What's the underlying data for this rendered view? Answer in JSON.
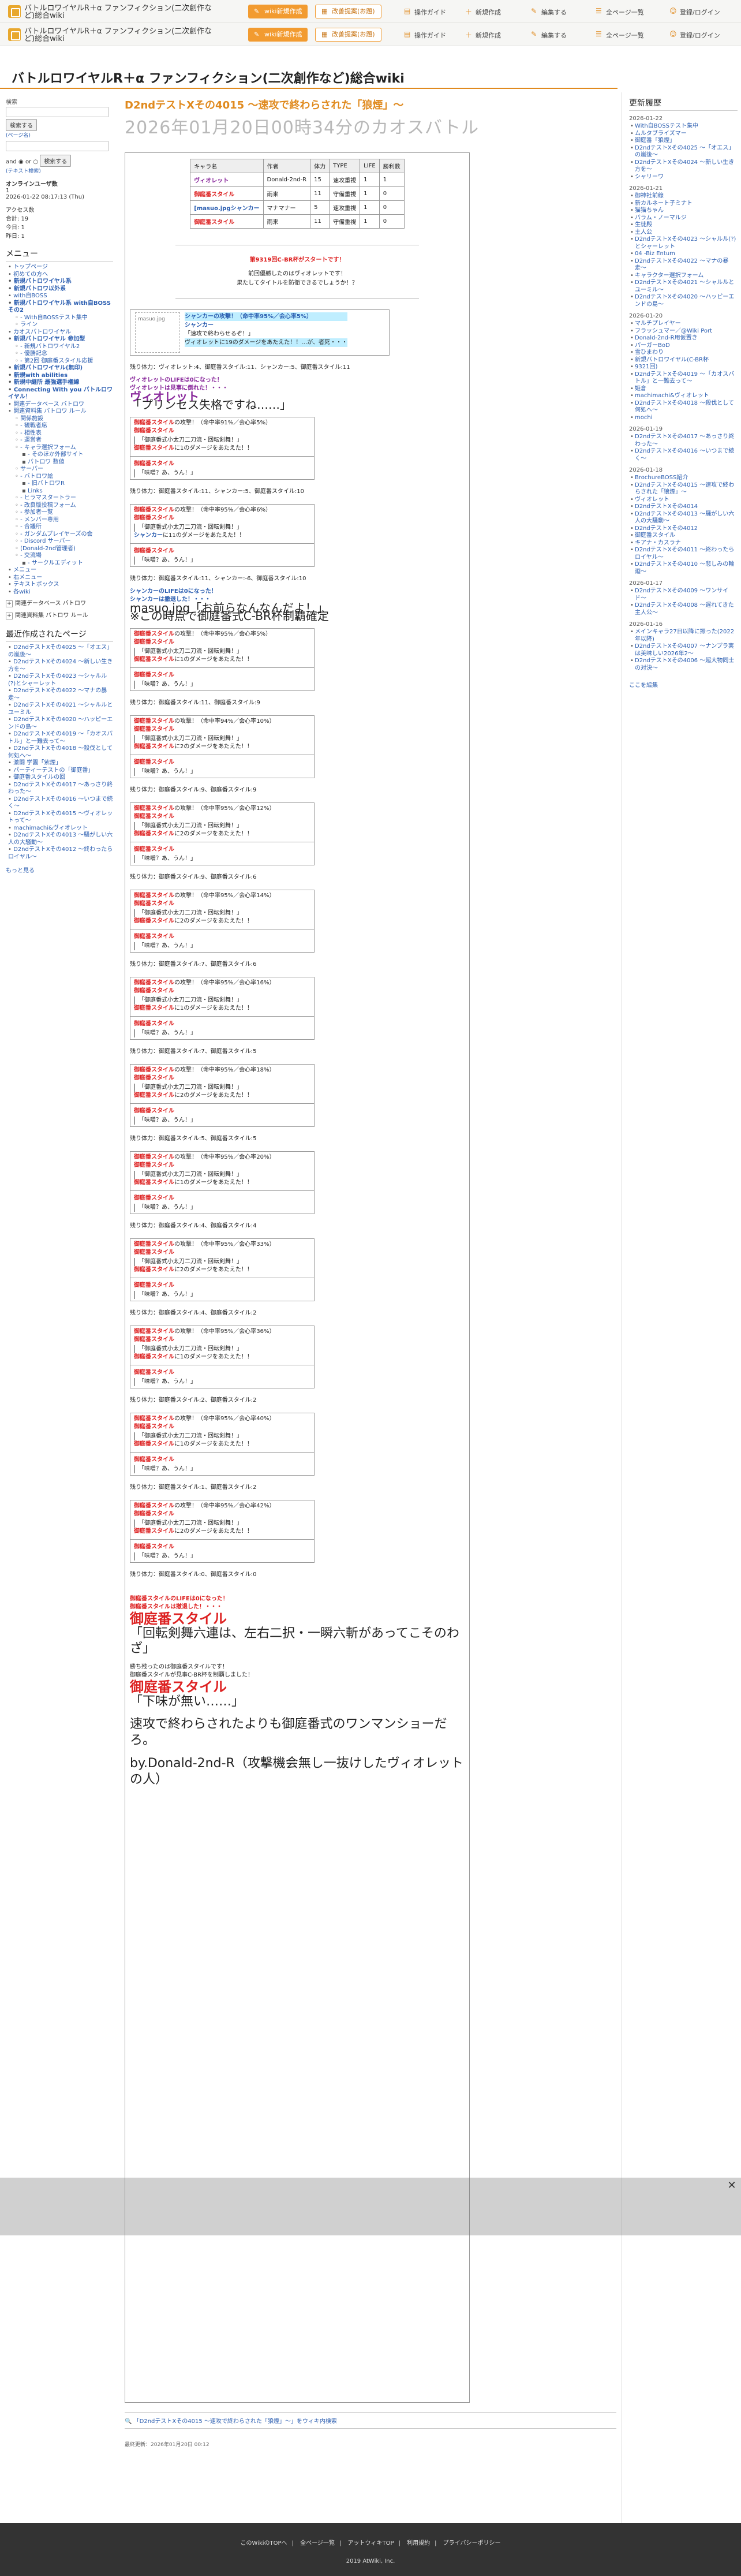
{
  "header": {
    "site_name": "バトルロワイヤルR＋α ファンフィクション(二次創作など)総合wiki",
    "wiki_new": "wiki新規作成",
    "feedback": "改善提案(お題)",
    "nav": [
      "操作ガイド",
      "新規作成",
      "編集する",
      "全ページ一覧",
      "登録/ログイン"
    ]
  },
  "wiki_title": "バトルロワイヤルR＋α ファンフィクション(二次創作など)総合wiki",
  "left": {
    "search_label": "検索",
    "search_button": "検索する",
    "search_label2": "(ページ名)",
    "and_label": "and",
    "or_label": "or",
    "search_button2": "検索する",
    "search_hint": "(テキスト検索)",
    "online_label": "オンラインユーザ数",
    "online_count": "1",
    "datetime": "2026-01-22 08:17:13 (Thu)",
    "access_label": "アクセス数",
    "access_total": "合計: 19",
    "access_today": "今日: 1",
    "access_yesterday": "昨日: 1",
    "menu_title": "メニュー",
    "menu": [
      {
        "t": "トップページ",
        "l": 1
      },
      {
        "t": "初めての方へ",
        "l": 1
      },
      {
        "t": "新規バトロワイヤル系",
        "l": 1,
        "s": true
      },
      {
        "t": "新規バトロワ以外系",
        "l": 1,
        "s": true
      },
      {
        "t": "with自BOSS",
        "l": 1
      },
      {
        "t": "新規バトロワイヤル系 with自BOSS その2",
        "l": 1,
        "s": true
      },
      {
        "t": "- With自BOSSテスト集中",
        "l": 2
      },
      {
        "t": "ライン",
        "l": 2
      },
      {
        "t": "カオスバトロワイヤル",
        "l": 1
      },
      {
        "t": "新規バトロワイヤル 参加型",
        "l": 1,
        "s": true
      },
      {
        "t": "- 新規バトロワイヤル2",
        "l": 2
      },
      {
        "t": "- 優勝記念",
        "l": 2
      },
      {
        "t": "- 第2回 御庭番スタイル応援",
        "l": 2
      },
      {
        "t": "新規バトロワイヤル(無印)",
        "l": 1,
        "s": true
      },
      {
        "t": "新規with abilities",
        "l": 1,
        "s": true
      },
      {
        "t": "新規中継所 最強選手権線",
        "l": 1,
        "s": true
      },
      {
        "t": "Connecting With you バトルロワイヤル！",
        "l": 1,
        "s": true
      },
      {
        "t": "関連データベース バトロワ",
        "l": 1
      },
      {
        "t": "関連資料集 バトロワ ルール",
        "l": 1
      },
      {
        "t": "関係施設",
        "l": 2
      },
      {
        "t": "- 観戦者席",
        "l": 2
      },
      {
        "t": "- 相性表",
        "l": 2
      },
      {
        "t": "- 運営者",
        "l": 2
      },
      {
        "t": "- キャラ選択フォーム",
        "l": 2
      },
      {
        "t": "- そのほか外部サイト",
        "l": 3
      },
      {
        "t": "バトロワ 数値 ",
        "l": 3
      },
      {
        "t": "サーバー",
        "l": 2
      },
      {
        "t": "- バトロワ絵",
        "l": 2
      },
      {
        "t": "- 旧バトロワR",
        "l": 3
      },
      {
        "t": "Links",
        "l": 3
      },
      {
        "t": "- ヒラマスタートラー",
        "l": 2
      },
      {
        "t": "- 改良版投稿フォーム",
        "l": 2
      },
      {
        "t": "- 参加者一覧 ",
        "l": 2
      },
      {
        "t": "- メンバー専用",
        "l": 2
      },
      {
        "t": "- 合議所",
        "l": 2
      },
      {
        "t": "- ガンダムプレイヤーズの会",
        "l": 2
      },
      {
        "t": "- Discord サーバー",
        "l": 2
      },
      {
        "t": "(Donald-2nd管理者)",
        "l": 2
      },
      {
        "t": "- 交流場",
        "l": 2
      },
      {
        "t": "- サークルエディット",
        "l": 3
      },
      {
        "t": "メニュー",
        "l": 1
      },
      {
        "t": "右メニュー",
        "l": 1
      },
      {
        "t": "テキストボックス",
        "l": 1
      },
      {
        "t": "各wiki",
        "l": 1
      }
    ],
    "toggles": [
      "関連データベース バトロワ",
      "関連資料集 バトロワ ルール"
    ],
    "recent_title": "最近作成されたページ",
    "recent": [
      "D2ndテストXその4025 〜「オエス」の嵐後〜",
      "D2ndテストXその4024 〜新しい生き方を〜",
      "D2ndテストXその4023 〜シャルル(?)とシャーレット",
      "D2ndテストXその4022 〜マナの暴走〜",
      "D2ndテストXその4021 〜シャルルとユーミル",
      "D2ndテストXその4020 〜ハッピーエンドの島〜",
      "D2ndテストXその4019 〜「カオスバトル」と一難去って〜",
      "D2ndテストXその4018 〜殺伐として何処へ〜",
      "激闘 学園「紫煙」",
      "パーティーテストの「御庭番」",
      "御庭番スタイルの回",
      "D2ndテストXその4017 〜あっさり終わった〜",
      "D2ndテストXその4016 〜いつまで続く〜",
      "D2ndテストXその4015 〜ヴィオレットって〜",
      "machimachi&ヴィオレット",
      "D2ndテストXその4013 〜騒がしい六人の大騒動〜",
      "D2ndテストXその4012 〜終わったらロイヤル〜"
    ],
    "more": "もっと見る"
  },
  "article": {
    "title": "D2ndテストXその4015 〜速攻で終わらされた「狼煙」〜",
    "date": "2026年01月20日00時34分のカオスバトル",
    "roster_headers": [
      "キャラ名",
      "作者",
      "体力",
      "TYPE",
      "LIFE",
      "勝利数"
    ],
    "roster": [
      {
        "name": "ヴィオレット",
        "author": "Donald-2nd-R",
        "hp": "15",
        "type": "速攻重視",
        "life": "1",
        "wins": "1",
        "c": "purple"
      },
      {
        "name": "御庭番スタイル",
        "author": "雨来",
        "hp": "11",
        "type": "守備重視",
        "life": "1",
        "wins": "0",
        "c": "red"
      },
      {
        "name": "シャンカー",
        "author": "マナマナー",
        "hp": "5",
        "type": "速攻重視",
        "life": "1",
        "wins": "0",
        "c": "blue",
        "img": "[masuo.jpg"
      },
      {
        "name": "御庭番スタイル",
        "author": "雨来",
        "hp": "11",
        "type": "守備重視",
        "life": "1",
        "wins": "0",
        "c": "red"
      }
    ],
    "start_line1": "第9319回C-BR杯がスタートです！",
    "start_line2": "前回優勝したのはヴィオレットです！",
    "start_line3": "果たしてタイトルを防衛できるでしょうか！？",
    "scene_img": "masuo.jpg",
    "scene_lines": [
      "シャンカーの攻撃！（命中率95%／会心率5%）",
      "シャンカー",
      "「速攻で終わらせるぞ！」",
      "ヴィオレットに19のダメージをあたえた！！…が、者死・・・"
    ],
    "remain1": "残り体力：ヴィオレット:4、御庭番スタイル:11、シャンカー:5、御庭番スタイル:11",
    "life_lost": "ヴィオレットのLIFEは0になった！",
    "life_lost2": "ヴィオレットは見事に倒れた！・・・",
    "violet_name": "ヴィオレット",
    "violet_quote": "「プリンセス失格ですね……」",
    "turns": [
      {
        "hit": "（命中率91%／会心率5%）",
        "dmg": "1",
        "remain": "残り体力：御庭番スタイル:11、シャンカー:5、御庭番スタイル:10"
      },
      {
        "hit": "（命中率95%／会心率6%）",
        "dmg": "11",
        "target": "シャンカー",
        "remain": "残り体力：御庭番スタイル:11、シャンカー:-6、御庭番スタイル:10"
      },
      {
        "hit": "（命中率95%／会心率5%）",
        "dmg": "1",
        "remain": "残り体力：御庭番スタイル:11、御庭番スタイル:9"
      },
      {
        "hit": "（命中率94%／会心率10%）",
        "dmg": "2",
        "remain": "残り体力：御庭番スタイル:9、御庭番スタイル:9"
      },
      {
        "hit": "（命中率95%／会心率12%）",
        "dmg": "2",
        "remain": "残り体力：御庭番スタイル:9、御庭番スタイル:6"
      },
      {
        "hit": "（命中率95%／会心率14%）",
        "dmg": "2",
        "remain": "残り体力：御庭番スタイル:7、御庭番スタイル:6"
      },
      {
        "hit": "（命中率95%／会心率16%）",
        "dmg": "1",
        "remain": "残り体力：御庭番スタイル:7、御庭番スタイル:5"
      },
      {
        "hit": "（命中率95%／会心率18%）",
        "dmg": "2",
        "remain": "残り体力：御庭番スタイル:5、御庭番スタイル:5"
      },
      {
        "hit": "（命中率95%／会心率20%）",
        "dmg": "1",
        "remain": "残り体力：御庭番スタイル:4、御庭番スタイル:4"
      },
      {
        "hit": "（命中率95%／会心率33%）",
        "dmg": "2",
        "remain": "残り体力：御庭番スタイル:4、御庭番スタイル:2"
      },
      {
        "hit": "（命中率95%／会心率36%）",
        "dmg": "1",
        "remain": "残り体力：御庭番スタイル:2、御庭番スタイル:2"
      },
      {
        "hit": "（命中率95%／会心率40%）",
        "dmg": "1",
        "remain": "残り体力：御庭番スタイル:1、御庭番スタイル:2"
      },
      {
        "hit": "（命中率95%／会心率42%）",
        "dmg": "2",
        "remain": "残り体力：御庭番スタイル:0、御庭番スタイル:0"
      }
    ],
    "shanker_dead1": "シャンカーのLIFEは0になった！",
    "shanker_dead2": "シャンカーは撤退した！・・・",
    "shanker_img": "masuo.jpg",
    "shanker_quote": "「お前らなんなんだよ！」",
    "note": "※この時点で御庭番式C-BR杯制覇確定",
    "attack_line": "の攻撃！",
    "oniwaban": "御庭番スタイル",
    "tech_line": "「御庭番式小太刀二刀流・回転剣舞！」",
    "dmg_prefix": "に",
    "dmg_suffix": "のダメージをあたえた！！",
    "reply_line": "「味噌？あ、うん！」",
    "end_lines": [
      "御庭番スタイルのLIFEは0になった！",
      "御庭番スタイルは撤退した！・・・"
    ],
    "end_head": "御庭番スタイル",
    "end_quote": "「回転剣舞六連は、左右二択・一瞬六斬があってこそのわざ」",
    "win_line1": "勝ち残ったのは御庭番スタイルです！",
    "win_line2": "御庭番スタイルが見事C-BR杯を制覇しました！",
    "win_head": "御庭番スタイル",
    "win_quote": "「下味が無い……」",
    "closing1": "速攻で終わらされたよりも御庭番式のワンマンショーだろ。",
    "closing2": "by.Donald-2nd-R（攻撃機会無し一抜けしたヴィオレットの人）"
  },
  "under": {
    "search_text": "「D2ndテストXその4015 〜速攻で終わらされた「狼煙」〜」をウィキ内検索",
    "updated": "最終更新：2026年01月20日 00:12"
  },
  "right": {
    "title": "更新履歴",
    "groups": [
      {
        "date": "2026-01-22",
        "items": [
          "With自BOSSテスト集中",
          "ムルタブライズマー",
          "御庭番「狼煙」",
          "D2ndテストXその4025 〜「オエス」の嵐後〜",
          "D2ndテストXその4024 〜新しい生き方を〜",
          "シャリーワ"
        ]
      },
      {
        "date": "2026-01-21",
        "items": [
          "御神社前線",
          "新カルネート子ミナト",
          "猫猫ちゃん",
          "バラム・ノーマルジ",
          "生徒殿",
          "主人公",
          "D2ndテストXその4023 〜シャルル(?)とシャーレット",
          "04 -Biz Entum",
          "D2ndテストXその4022 〜マナの暴走〜",
          "キャラクター選択フォーム",
          "D2ndテストXその4021 〜シャルルとユーミル〜",
          "D2ndテストXその4020 〜ハッピーエンドの島〜"
        ]
      },
      {
        "date": "2026-01-20",
        "items": [
          "マルチプレイヤー",
          "フラッシュマー／@Wiki Port",
          "Donald-2nd-R用仮置き",
          "パーガーBoD",
          "雪ひまわり",
          "新規バトロワイヤル(C-BR杯",
          "9321回)",
          "D2ndテストXその4019 〜「カオスバトル」と一難去って〜",
          "姫倉",
          "machimachi&ヴィオレット",
          "D2ndテストXその4018 〜殺伐として何処へ〜",
          "mochi"
        ]
      },
      {
        "date": "2026-01-19",
        "items": [
          "D2ndテストXその4017 〜あっさり終わった〜",
          "D2ndテストXその4016 〜いつまで続く〜"
        ]
      },
      {
        "date": "2026-01-18",
        "items": [
          "BrochureBOSS紹介",
          "D2ndテストXその4015 〜速攻で終わらされた「狼煙」〜",
          "ヴィオレット",
          "D2ndテストXその4014",
          "D2ndテストXその4013 〜騒がしい六人の大騒動〜",
          "D2ndテストXその4012",
          "御庭番スタイル",
          "キアナ・カスラナ",
          "D2ndテストXその4011 〜終わったらロイヤル〜",
          "D2ndテストXその4010 〜悲しみの輪廻〜"
        ]
      },
      {
        "date": "2026-01-17",
        "items": [
          "D2ndテストXその4009 〜ワンサイド〜",
          "D2ndテストXその4008 〜遅れてきた主人公〜"
        ]
      },
      {
        "date": "2026-01-16",
        "items": [
          "メインキャラ27日以降に振った(2022年以降)",
          "D2ndテストXその4007 〜ナンプラ実は美味しい2026年2〜",
          "D2ndテストXその4006 〜超大物同士の対決〜"
        ]
      }
    ],
    "edit": "ここを編集"
  },
  "footer": {
    "links": [
      "このWikiのTOPへ",
      "全ページ一覧",
      "アットウィキTOP",
      "利用規約",
      "プライバシーポリシー"
    ],
    "copy": "2019 AtWiki, Inc."
  }
}
